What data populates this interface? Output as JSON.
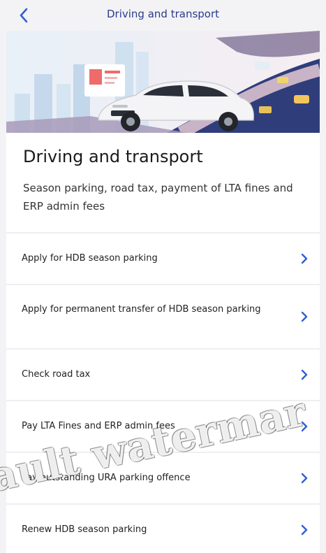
{
  "header": {
    "title": "Driving and transport"
  },
  "intro": {
    "title": "Driving and transport",
    "subtitle": "Season parking, road tax, payment of LTA fines and ERP admin fees"
  },
  "items": [
    {
      "label": "Apply for HDB season parking"
    },
    {
      "label": "Apply for permanent transfer of HDB season parking"
    },
    {
      "label": "Check road tax"
    },
    {
      "label": "Pay LTA Fines and ERP admin fees"
    },
    {
      "label": "Pay outstanding URA parking offence"
    },
    {
      "label": "Renew HDB season parking"
    }
  ],
  "icons": {
    "back": "chevron-left-icon",
    "item_arrow": "chevron-right-icon"
  },
  "colors": {
    "accent": "#2b3a8f",
    "chevron": "#2f5fd0",
    "background": "#f3f3f5"
  },
  "watermark": "ault watermar"
}
